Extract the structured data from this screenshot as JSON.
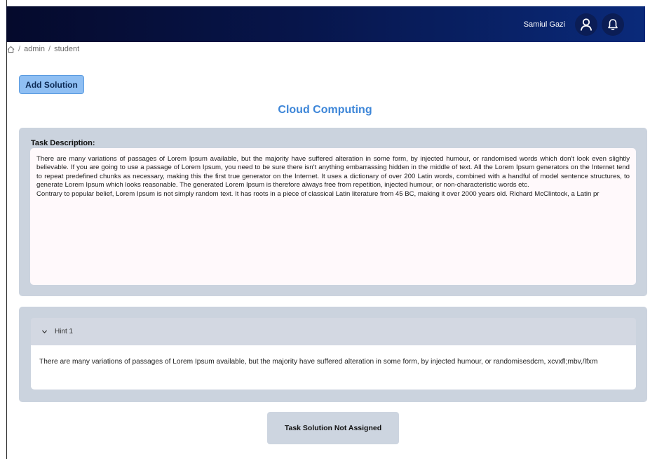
{
  "header": {
    "user_name": "Samiul Gazi",
    "icons": [
      "user-icon",
      "bell-icon"
    ]
  },
  "breadcrumb": {
    "home_icon": "home-icon",
    "separator": "/",
    "items": [
      "admin",
      "student"
    ]
  },
  "actions": {
    "add_solution_label": "Add Solution"
  },
  "page": {
    "title": "Cloud Computing"
  },
  "task": {
    "label": "Task Description:",
    "paragraphs": [
      "There are many variations of passages of Lorem Ipsum available, but the majority have suffered alteration in some form, by injected humour, or randomised words which don't look even slightly believable. If you are going to use a passage of Lorem Ipsum, you need to be sure there isn't anything embarrassing hidden in the middle of text. All the Lorem Ipsum generators on the Internet tend to repeat predefined chunks as necessary, making this the first true generator on the Internet. It uses a dictionary of over 200 Latin words, combined with a handful of model sentence structures, to generate Lorem Ipsum which looks reasonable. The generated Lorem Ipsum is therefore always free from repetition, injected humour, or non-characteristic words etc.",
      "Contrary to popular belief, Lorem Ipsum is not simply random text. It has roots in a piece of classical Latin literature from 45 BC, making it over 2000 years old. Richard McClintock, a Latin pr"
    ]
  },
  "hints": [
    {
      "title": "Hint 1",
      "expanded": true,
      "text": "There are many variations of passages of Lorem Ipsum available, but the majority have suffered alteration in some form, by injected humour, or randomisesdcm, xcvxfl;mbv,/lfxm"
    }
  ],
  "solution": {
    "status_label": "Task Solution Not Assigned"
  },
  "colors": {
    "header_start": "#050a2c",
    "header_end": "#0a2a7a",
    "accent": "#3d86d8",
    "button_bg": "#8fbff3",
    "card_bg": "#cbd3de"
  }
}
